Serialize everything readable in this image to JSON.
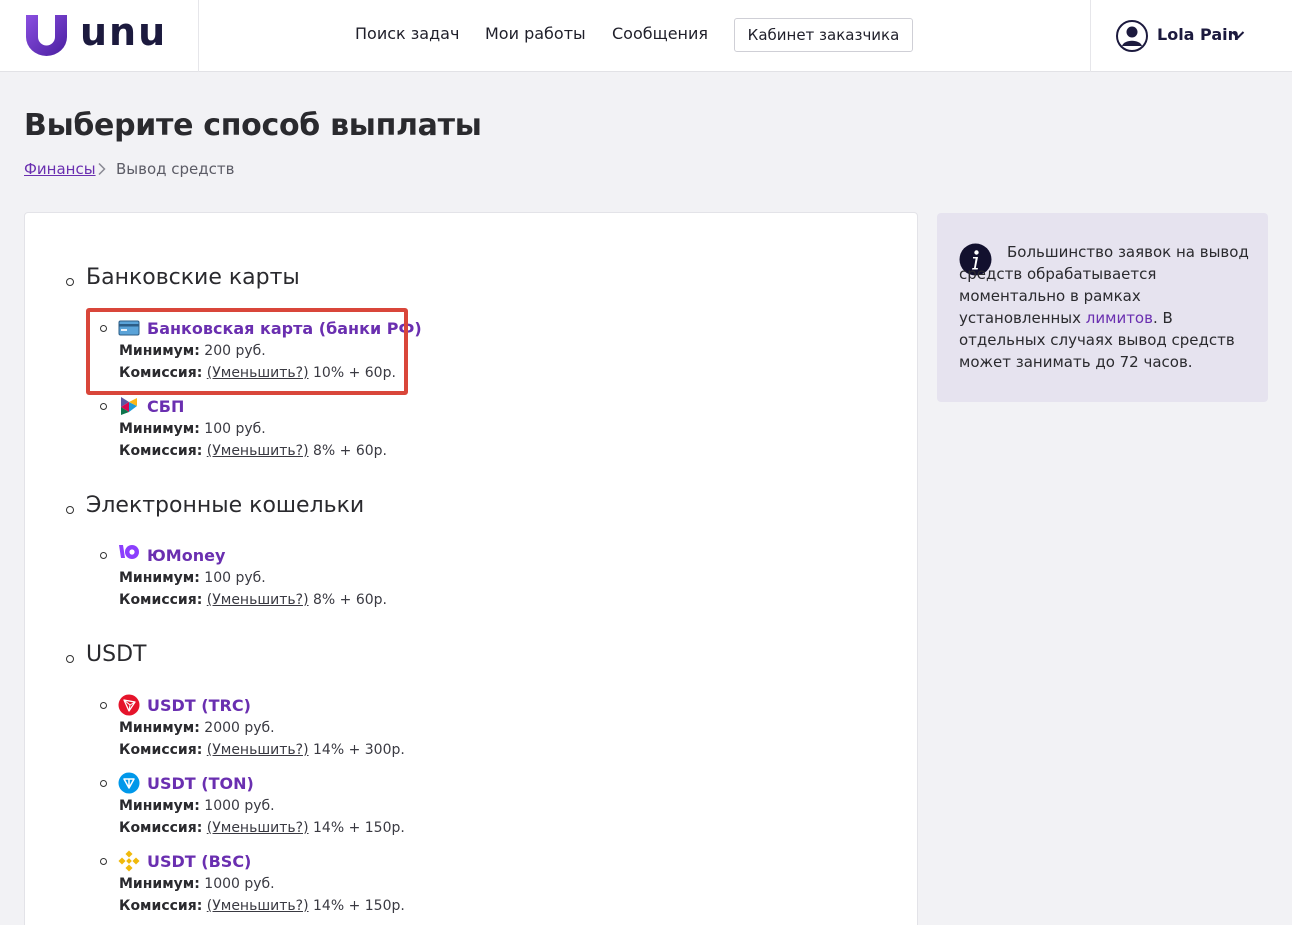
{
  "header": {
    "logo_text": "unu",
    "nav": [
      "Поиск задач",
      "Мои работы",
      "Сообщения"
    ],
    "cabinet_button": "Кабинет заказчика",
    "user_name": "Lola Pain",
    "brand_color": "#6a2fb0"
  },
  "page": {
    "title": "Выберите способ выплаты",
    "breadcrumb": {
      "link": "Финансы",
      "current": "Вывод средств"
    }
  },
  "labels": {
    "minimum": "Минимум:",
    "commission": "Комиссия:",
    "reduce": "(Уменьшить?)"
  },
  "sections": [
    {
      "title": "Банковские карты",
      "methods": [
        {
          "name": "Банковская карта (банки РФ)",
          "icon": "bank-card-icon",
          "minimum": "200 руб.",
          "commission": "10% + 60р."
        },
        {
          "name": "СБП",
          "icon": "sbp-icon",
          "minimum": "100 руб.",
          "commission": "8% + 60р."
        }
      ]
    },
    {
      "title": "Электронные кошельки",
      "methods": [
        {
          "name": "ЮMoney",
          "icon": "yumoney-icon",
          "minimum": "100 руб.",
          "commission": "8% + 60р."
        }
      ]
    },
    {
      "title": "USDT",
      "methods": [
        {
          "name": "USDT (TRC)",
          "icon": "tron-icon",
          "minimum": "2000 руб.",
          "commission": "14% + 300р."
        },
        {
          "name": "USDT (TON)",
          "icon": "ton-icon",
          "minimum": "1000 руб.",
          "commission": "14% + 150р."
        },
        {
          "name": "USDT (BSC)",
          "icon": "bsc-icon",
          "minimum": "1000 руб.",
          "commission": "14% + 150р."
        }
      ]
    }
  ],
  "info_panel": {
    "text_before": "Большинство заявок на вывод средств обрабатывается моментально в рамках установленных ",
    "link": "лимитов",
    "text_after": ". В отдельных случаях вывод средств может занимать до 72 часов."
  }
}
